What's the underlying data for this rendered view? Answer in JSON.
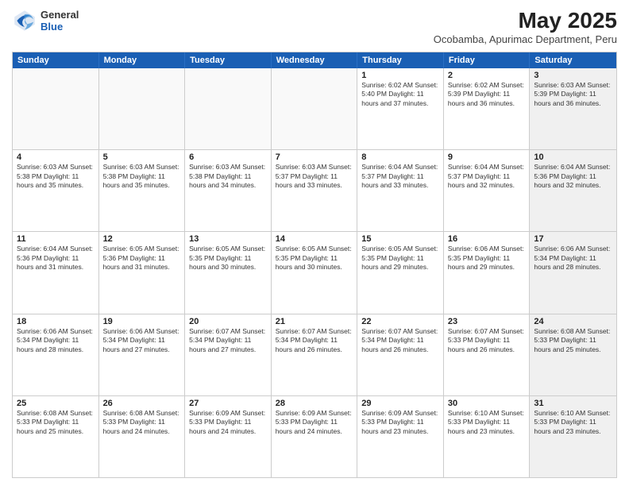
{
  "header": {
    "logo_general": "General",
    "logo_blue": "Blue",
    "month_year": "May 2025",
    "location": "Ocobamba, Apurimac Department, Peru"
  },
  "weekdays": [
    "Sunday",
    "Monday",
    "Tuesday",
    "Wednesday",
    "Thursday",
    "Friday",
    "Saturday"
  ],
  "rows": [
    [
      {
        "day": "",
        "info": "",
        "empty": true
      },
      {
        "day": "",
        "info": "",
        "empty": true
      },
      {
        "day": "",
        "info": "",
        "empty": true
      },
      {
        "day": "",
        "info": "",
        "empty": true
      },
      {
        "day": "1",
        "info": "Sunrise: 6:02 AM\nSunset: 5:40 PM\nDaylight: 11 hours\nand 37 minutes.",
        "empty": false
      },
      {
        "day": "2",
        "info": "Sunrise: 6:02 AM\nSunset: 5:39 PM\nDaylight: 11 hours\nand 36 minutes.",
        "empty": false
      },
      {
        "day": "3",
        "info": "Sunrise: 6:03 AM\nSunset: 5:39 PM\nDaylight: 11 hours\nand 36 minutes.",
        "empty": false,
        "shaded": true
      }
    ],
    [
      {
        "day": "4",
        "info": "Sunrise: 6:03 AM\nSunset: 5:38 PM\nDaylight: 11 hours\nand 35 minutes.",
        "empty": false
      },
      {
        "day": "5",
        "info": "Sunrise: 6:03 AM\nSunset: 5:38 PM\nDaylight: 11 hours\nand 35 minutes.",
        "empty": false
      },
      {
        "day": "6",
        "info": "Sunrise: 6:03 AM\nSunset: 5:38 PM\nDaylight: 11 hours\nand 34 minutes.",
        "empty": false
      },
      {
        "day": "7",
        "info": "Sunrise: 6:03 AM\nSunset: 5:37 PM\nDaylight: 11 hours\nand 33 minutes.",
        "empty": false
      },
      {
        "day": "8",
        "info": "Sunrise: 6:04 AM\nSunset: 5:37 PM\nDaylight: 11 hours\nand 33 minutes.",
        "empty": false
      },
      {
        "day": "9",
        "info": "Sunrise: 6:04 AM\nSunset: 5:37 PM\nDaylight: 11 hours\nand 32 minutes.",
        "empty": false
      },
      {
        "day": "10",
        "info": "Sunrise: 6:04 AM\nSunset: 5:36 PM\nDaylight: 11 hours\nand 32 minutes.",
        "empty": false,
        "shaded": true
      }
    ],
    [
      {
        "day": "11",
        "info": "Sunrise: 6:04 AM\nSunset: 5:36 PM\nDaylight: 11 hours\nand 31 minutes.",
        "empty": false
      },
      {
        "day": "12",
        "info": "Sunrise: 6:05 AM\nSunset: 5:36 PM\nDaylight: 11 hours\nand 31 minutes.",
        "empty": false
      },
      {
        "day": "13",
        "info": "Sunrise: 6:05 AM\nSunset: 5:35 PM\nDaylight: 11 hours\nand 30 minutes.",
        "empty": false
      },
      {
        "day": "14",
        "info": "Sunrise: 6:05 AM\nSunset: 5:35 PM\nDaylight: 11 hours\nand 30 minutes.",
        "empty": false
      },
      {
        "day": "15",
        "info": "Sunrise: 6:05 AM\nSunset: 5:35 PM\nDaylight: 11 hours\nand 29 minutes.",
        "empty": false
      },
      {
        "day": "16",
        "info": "Sunrise: 6:06 AM\nSunset: 5:35 PM\nDaylight: 11 hours\nand 29 minutes.",
        "empty": false
      },
      {
        "day": "17",
        "info": "Sunrise: 6:06 AM\nSunset: 5:34 PM\nDaylight: 11 hours\nand 28 minutes.",
        "empty": false,
        "shaded": true
      }
    ],
    [
      {
        "day": "18",
        "info": "Sunrise: 6:06 AM\nSunset: 5:34 PM\nDaylight: 11 hours\nand 28 minutes.",
        "empty": false
      },
      {
        "day": "19",
        "info": "Sunrise: 6:06 AM\nSunset: 5:34 PM\nDaylight: 11 hours\nand 27 minutes.",
        "empty": false
      },
      {
        "day": "20",
        "info": "Sunrise: 6:07 AM\nSunset: 5:34 PM\nDaylight: 11 hours\nand 27 minutes.",
        "empty": false
      },
      {
        "day": "21",
        "info": "Sunrise: 6:07 AM\nSunset: 5:34 PM\nDaylight: 11 hours\nand 26 minutes.",
        "empty": false
      },
      {
        "day": "22",
        "info": "Sunrise: 6:07 AM\nSunset: 5:34 PM\nDaylight: 11 hours\nand 26 minutes.",
        "empty": false
      },
      {
        "day": "23",
        "info": "Sunrise: 6:07 AM\nSunset: 5:33 PM\nDaylight: 11 hours\nand 26 minutes.",
        "empty": false
      },
      {
        "day": "24",
        "info": "Sunrise: 6:08 AM\nSunset: 5:33 PM\nDaylight: 11 hours\nand 25 minutes.",
        "empty": false,
        "shaded": true
      }
    ],
    [
      {
        "day": "25",
        "info": "Sunrise: 6:08 AM\nSunset: 5:33 PM\nDaylight: 11 hours\nand 25 minutes.",
        "empty": false
      },
      {
        "day": "26",
        "info": "Sunrise: 6:08 AM\nSunset: 5:33 PM\nDaylight: 11 hours\nand 24 minutes.",
        "empty": false
      },
      {
        "day": "27",
        "info": "Sunrise: 6:09 AM\nSunset: 5:33 PM\nDaylight: 11 hours\nand 24 minutes.",
        "empty": false
      },
      {
        "day": "28",
        "info": "Sunrise: 6:09 AM\nSunset: 5:33 PM\nDaylight: 11 hours\nand 24 minutes.",
        "empty": false
      },
      {
        "day": "29",
        "info": "Sunrise: 6:09 AM\nSunset: 5:33 PM\nDaylight: 11 hours\nand 23 minutes.",
        "empty": false
      },
      {
        "day": "30",
        "info": "Sunrise: 6:10 AM\nSunset: 5:33 PM\nDaylight: 11 hours\nand 23 minutes.",
        "empty": false
      },
      {
        "day": "31",
        "info": "Sunrise: 6:10 AM\nSunset: 5:33 PM\nDaylight: 11 hours\nand 23 minutes.",
        "empty": false,
        "shaded": true
      }
    ]
  ]
}
